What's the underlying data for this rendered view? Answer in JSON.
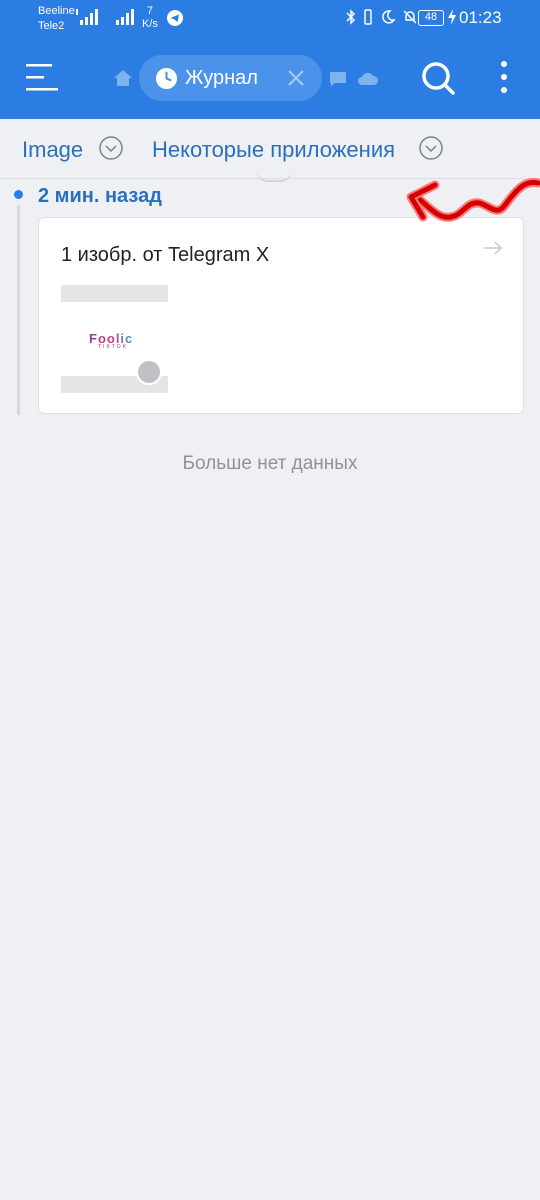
{
  "status_bar": {
    "carrier1": "Beeline",
    "carrier2": "Tele2",
    "speed_value": "7",
    "speed_unit": "K/s",
    "battery": "48",
    "time": "01:23"
  },
  "app_bar": {
    "tab_label": "Журнал",
    "accent_color": "#2b7de3"
  },
  "filters": {
    "type_label": "Image",
    "apps_label": "Некоторые приложения"
  },
  "timeline": {
    "group_label": "2 мин. назад",
    "card_title": "1 изобр. от Telegram X",
    "thumb_logo_top": "Foolic",
    "thumb_logo_bottom": "TIKTOK"
  },
  "footer": {
    "no_more": "Больше нет данных"
  }
}
